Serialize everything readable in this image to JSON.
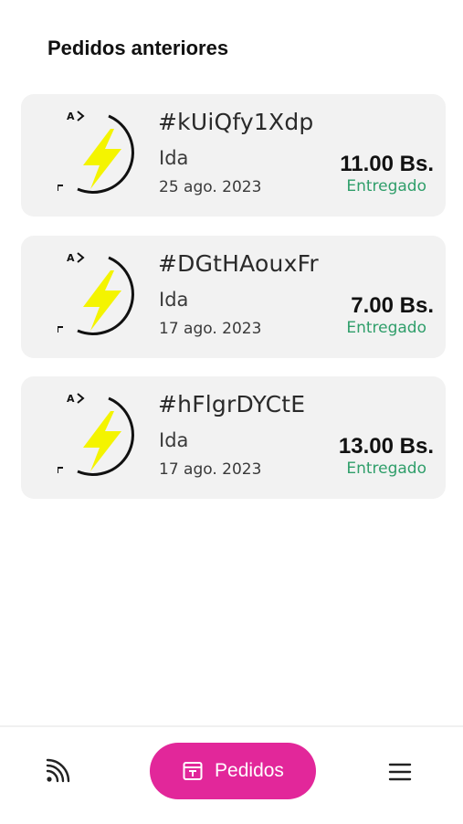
{
  "page": {
    "title": "Pedidos anteriores"
  },
  "orders": [
    {
      "code": "#kUiQfy1Xdp",
      "type": "Ida",
      "date": "25 ago. 2023",
      "price": "11.00 Bs.",
      "status": "Entregado"
    },
    {
      "code": "#DGtHAouxFr",
      "type": "Ida",
      "date": "17 ago. 2023",
      "price": "7.00 Bs.",
      "status": "Entregado"
    },
    {
      "code": "#hFlgrDYCtE",
      "type": "Ida",
      "date": "17 ago. 2023",
      "price": "13.00 Bs.",
      "status": "Entregado"
    }
  ],
  "nav": {
    "left_icon": "rss-icon",
    "active_label": "Pedidos",
    "active_icon": "receipt-icon",
    "right_icon": "menu-icon"
  },
  "colors": {
    "accent": "#e2279a",
    "status_green": "#2f9e6a",
    "bolt_yellow": "#f4f400"
  }
}
